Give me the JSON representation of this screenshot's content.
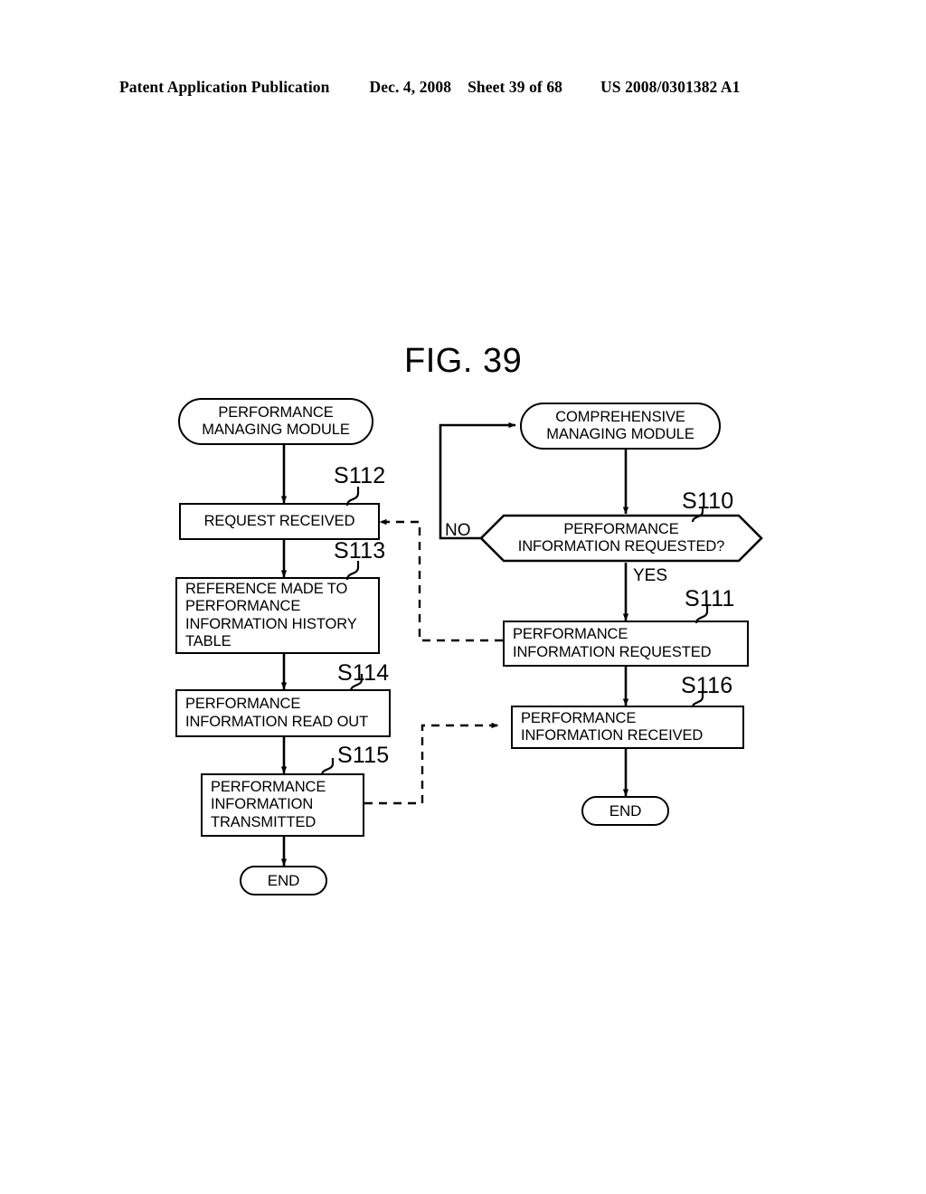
{
  "header": {
    "publication": "Patent Application Publication",
    "date": "Dec. 4, 2008",
    "sheet": "Sheet 39 of 68",
    "patent_number": "US 2008/0301382 A1"
  },
  "figure": {
    "title": "FIG. 39",
    "type": "flowchart",
    "lanes": [
      {
        "name": "performance-managing-module",
        "title": "PERFORMANCE MANAGING MODULE"
      },
      {
        "name": "comprehensive-managing-module",
        "title": "COMPREHENSIVE MANAGING MODULE"
      }
    ]
  },
  "nodes": {
    "start_left": {
      "shape": "stadium",
      "lines": [
        "PERFORMANCE",
        "MANAGING MODULE"
      ]
    },
    "start_right": {
      "shape": "stadium",
      "lines": [
        "COMPREHENSIVE",
        "MANAGING MODULE"
      ]
    },
    "s112": {
      "shape": "rect",
      "step": "S112",
      "lines": [
        "REQUEST RECEIVED"
      ]
    },
    "s113": {
      "shape": "rect",
      "step": "S113",
      "lines": [
        "REFERENCE MADE TO",
        "PERFORMANCE",
        "INFORMATION HISTORY",
        "TABLE"
      ]
    },
    "s114": {
      "shape": "rect",
      "step": "S114",
      "lines": [
        "PERFORMANCE",
        "INFORMATION READ OUT"
      ]
    },
    "s115": {
      "shape": "rect",
      "step": "S115",
      "lines": [
        "PERFORMANCE",
        "INFORMATION",
        "TRANSMITTED"
      ]
    },
    "end_left": {
      "shape": "stadium",
      "lines": [
        "END"
      ]
    },
    "s110": {
      "shape": "hexagon",
      "step": "S110",
      "lines": [
        "PERFORMANCE",
        "INFORMATION REQUESTED?"
      ]
    },
    "s111": {
      "shape": "rect",
      "step": "S111",
      "lines": [
        "PERFORMANCE",
        "INFORMATION REQUESTED"
      ]
    },
    "s116": {
      "shape": "rect",
      "step": "S116",
      "lines": [
        "PERFORMANCE",
        "INFORMATION RECEIVED"
      ]
    },
    "end_right": {
      "shape": "stadium",
      "lines": [
        "END"
      ]
    }
  },
  "branches": {
    "no": "NO",
    "yes": "YES"
  },
  "edges": [
    {
      "from": "start_left",
      "to": "s112",
      "style": "solid"
    },
    {
      "from": "s112",
      "to": "s113",
      "style": "solid"
    },
    {
      "from": "s113",
      "to": "s114",
      "style": "solid"
    },
    {
      "from": "s114",
      "to": "s115",
      "style": "solid"
    },
    {
      "from": "s115",
      "to": "end_left",
      "style": "solid"
    },
    {
      "from": "start_right",
      "to": "s110",
      "style": "solid"
    },
    {
      "from": "s110",
      "to": "start_right",
      "style": "solid",
      "label": "NO"
    },
    {
      "from": "s110",
      "to": "s111",
      "style": "solid",
      "label": "YES"
    },
    {
      "from": "s111",
      "to": "s116",
      "style": "solid"
    },
    {
      "from": "s116",
      "to": "end_right",
      "style": "solid"
    },
    {
      "from": "s111",
      "to": "s112",
      "style": "dashed"
    },
    {
      "from": "s115",
      "to": "s116",
      "style": "dashed"
    }
  ],
  "colors": {
    "ink": "#000000",
    "paper": "#ffffff"
  }
}
